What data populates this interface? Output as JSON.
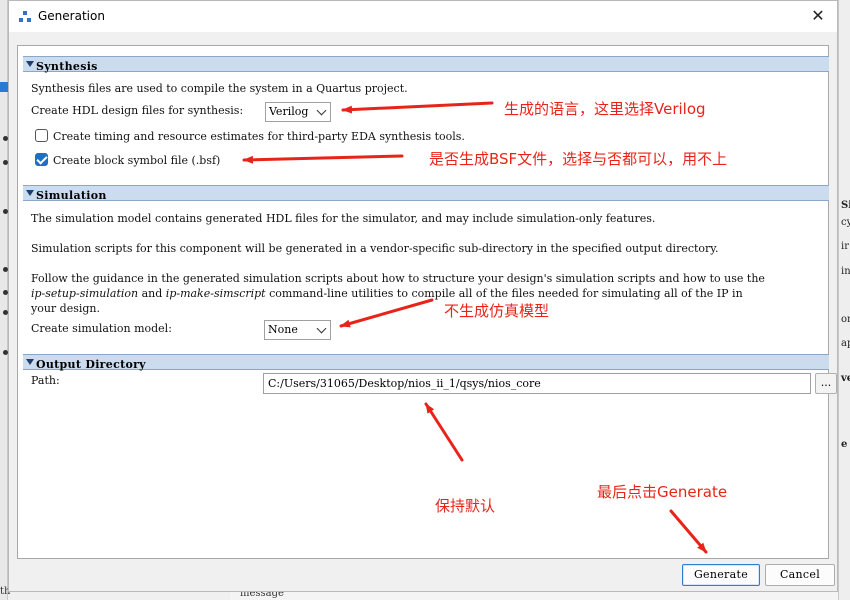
{
  "window": {
    "title": "Generation"
  },
  "synthesis": {
    "header": "Synthesis",
    "description": "Synthesis files are used to compile the system in a Quartus project.",
    "hdl_label": "Create HDL design files for synthesis:",
    "hdl_value": "Verilog",
    "timing_label": "Create timing and resource estimates for third-party EDA synthesis tools.",
    "timing_checked": false,
    "bsf_label": "Create block symbol file (.bsf)",
    "bsf_checked": true
  },
  "simulation": {
    "header": "Simulation",
    "desc1": "The simulation model contains generated HDL files for the simulator, and may include simulation-only features.",
    "desc2": "Simulation scripts for this component will be generated in a vendor-specific sub-directory in the specified output directory.",
    "desc3_a": "Follow the guidance in the generated simulation scripts about how to structure your design's simulation scripts and how to use the",
    "desc3_b_em1": "ip-setup-simulation",
    "desc3_b_and": "and",
    "desc3_b_em2": "ip-make-simscript",
    "desc3_b_rest": "command-line utilities to compile all of the files needed for simulating all of the IP in",
    "desc3_c": "your design.",
    "model_label": "Create simulation model:",
    "model_value": "None"
  },
  "output": {
    "header": "Output Directory",
    "path_label": "Path:",
    "path_value": "C:/Users/31065/Desktop/nios_ii_1/qsys/nios_core",
    "browse_label": "..."
  },
  "buttons": {
    "generate": "Generate",
    "cancel": "Cancel"
  },
  "annotations": {
    "language": "生成的语言，这里选择Verilog",
    "bsf": "是否生成BSF文件，选择与否都可以，用不上",
    "sim": "不生成仿真模型",
    "keep": "保持默认",
    "generate": "最后点击Generate"
  },
  "background": {
    "right_texts": [
      "Simulati",
      "cy",
      "ir",
      "in",
      "or",
      "ap",
      "ve",
      "e"
    ],
    "bottom_text": "message",
    "bottom_left_text": "th"
  },
  "colors": {
    "annotation": "#e8241a",
    "section_header": "#cbdcef",
    "checkbox_checked": "#1f6fc5"
  }
}
